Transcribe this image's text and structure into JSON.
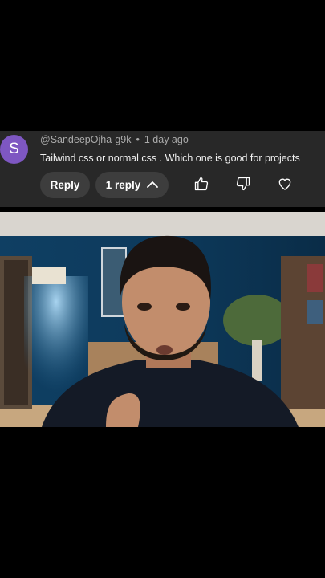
{
  "comment": {
    "avatar_letter": "S",
    "avatar_color": "#7e57c2",
    "author": "@SandeepOjha-g9k",
    "separator": "•",
    "time": "1 day ago",
    "text": "Tailwind css or normal css . Which one is good for projects"
  },
  "actions": {
    "reply_label": "Reply",
    "replies_label": "1 reply",
    "icons": [
      "chevron-up-icon",
      "thumbs-up-icon",
      "thumbs-down-icon",
      "heart-icon"
    ]
  },
  "colors": {
    "card_bg": "#282828",
    "pill_bg": "#3d3d3d",
    "wall": "#0d3350"
  }
}
